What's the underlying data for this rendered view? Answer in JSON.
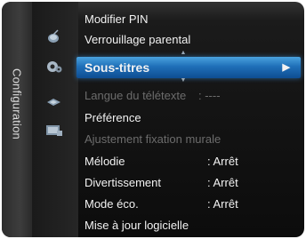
{
  "sidebar": {
    "title": "Configuration"
  },
  "icons": [
    "antenna-icon",
    "settings-gear-icon",
    "satellite-icon",
    "input-icon"
  ],
  "menu": {
    "items": [
      {
        "label": "Modifier PIN",
        "value": "",
        "state": "normal"
      },
      {
        "label": "Verrouillage parental",
        "value": "",
        "state": "normal"
      },
      {
        "label": "Sous-titres",
        "value": "",
        "state": "selected"
      },
      {
        "label": "Langue du télétexte",
        "value": ": ----",
        "state": "disabled"
      },
      {
        "label": "Préférence",
        "value": "",
        "state": "normal"
      },
      {
        "label": "Ajustement fixation murale",
        "value": "",
        "state": "disabled"
      },
      {
        "label": "Mélodie",
        "value": ": Arrêt",
        "state": "normal"
      },
      {
        "label": "Divertissement",
        "value": ": Arrêt",
        "state": "normal"
      },
      {
        "label": "Mode éco.",
        "value": ": Arrêt",
        "state": "normal"
      },
      {
        "label": "Mise à jour logicielle",
        "value": "",
        "state": "normal"
      }
    ],
    "selected_arrow": "▶"
  },
  "colors": {
    "highlight": "#1f6fb8",
    "text": "#f2f2f2",
    "disabled_text": "#6c6c6c",
    "background": "#141414"
  }
}
